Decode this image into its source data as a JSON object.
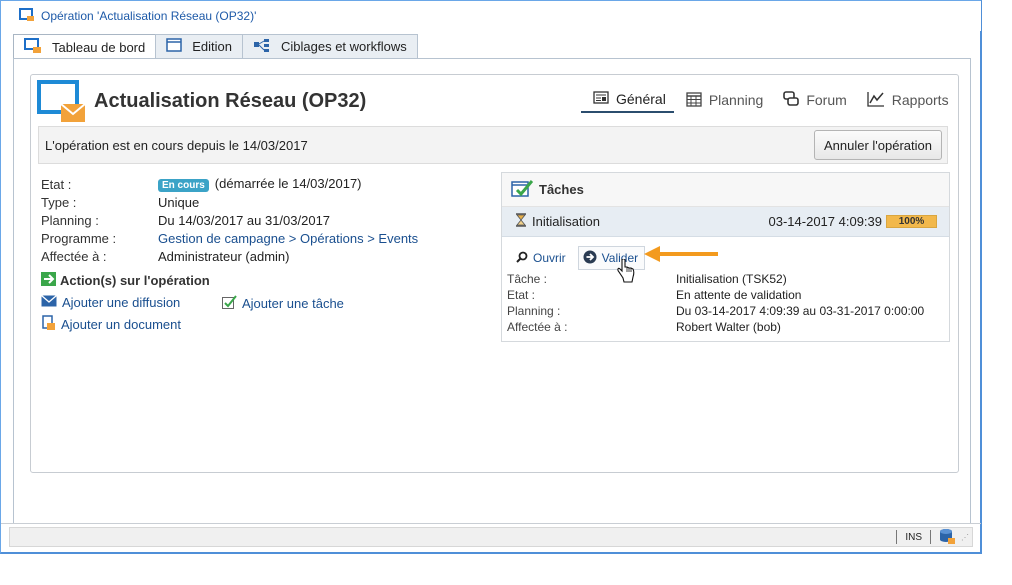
{
  "window": {
    "title": "Opération 'Actualisation Réseau (OP32)'"
  },
  "tabs": [
    {
      "label": "Tableau de bord",
      "icon": "dashboard-icon"
    },
    {
      "label": "Edition",
      "icon": "form-icon"
    },
    {
      "label": "Ciblages et workflows",
      "icon": "workflow-icon"
    }
  ],
  "operation": {
    "title": "Actualisation Réseau (OP32)",
    "status_message": "L'opération est en cours depuis le 14/03/2017",
    "cancel_button": "Annuler l'opération"
  },
  "right_tabs": [
    {
      "label": "Général",
      "icon": "general-icon"
    },
    {
      "label": "Planning",
      "icon": "calendar-icon"
    },
    {
      "label": "Forum",
      "icon": "forum-icon"
    },
    {
      "label": "Rapports",
      "icon": "chart-icon"
    }
  ],
  "properties": {
    "etat_label": "Etat :",
    "etat_badge": "En cours",
    "etat_value": "(démarrée le 14/03/2017)",
    "type_label": "Type :",
    "type_value": "Unique",
    "planning_label": "Planning :",
    "planning_value": "Du 14/03/2017 au 31/03/2017",
    "programme_label": "Programme :",
    "programme_value": "Gestion de campagne > Opérations > Events",
    "affectee_label": "Affectée à :",
    "affectee_value": "Administrateur (admin)"
  },
  "actions": {
    "title": "Action(s) sur l'opération",
    "add_delivery": "Ajouter une diffusion",
    "add_task": "Ajouter une tâche",
    "add_document": "Ajouter un document"
  },
  "tasks": {
    "title": "Tâches",
    "row": {
      "name": "Initialisation",
      "date": "03-14-2017 4:09:39",
      "progress_label": "100%",
      "progress": 1.0
    },
    "open_button": "Ouvrir",
    "validate_button": "Valider",
    "tache_label": "Tâche :",
    "tache_value": "Initialisation (TSK52)",
    "etat_label": "Etat :",
    "etat_value": "En attente de validation",
    "planning_label": "Planning :",
    "planning_value": "Du 03-14-2017 4:09:39 au 03-31-2017 0:00:00",
    "affectee_label": "Affectée à :",
    "affectee_value": "Robert Walter (bob)"
  },
  "statusbar": {
    "ins": "INS"
  },
  "colors": {
    "accent": "#1e5aa8",
    "arrow": "#f39a1e",
    "badge": "#3ba3c7"
  }
}
